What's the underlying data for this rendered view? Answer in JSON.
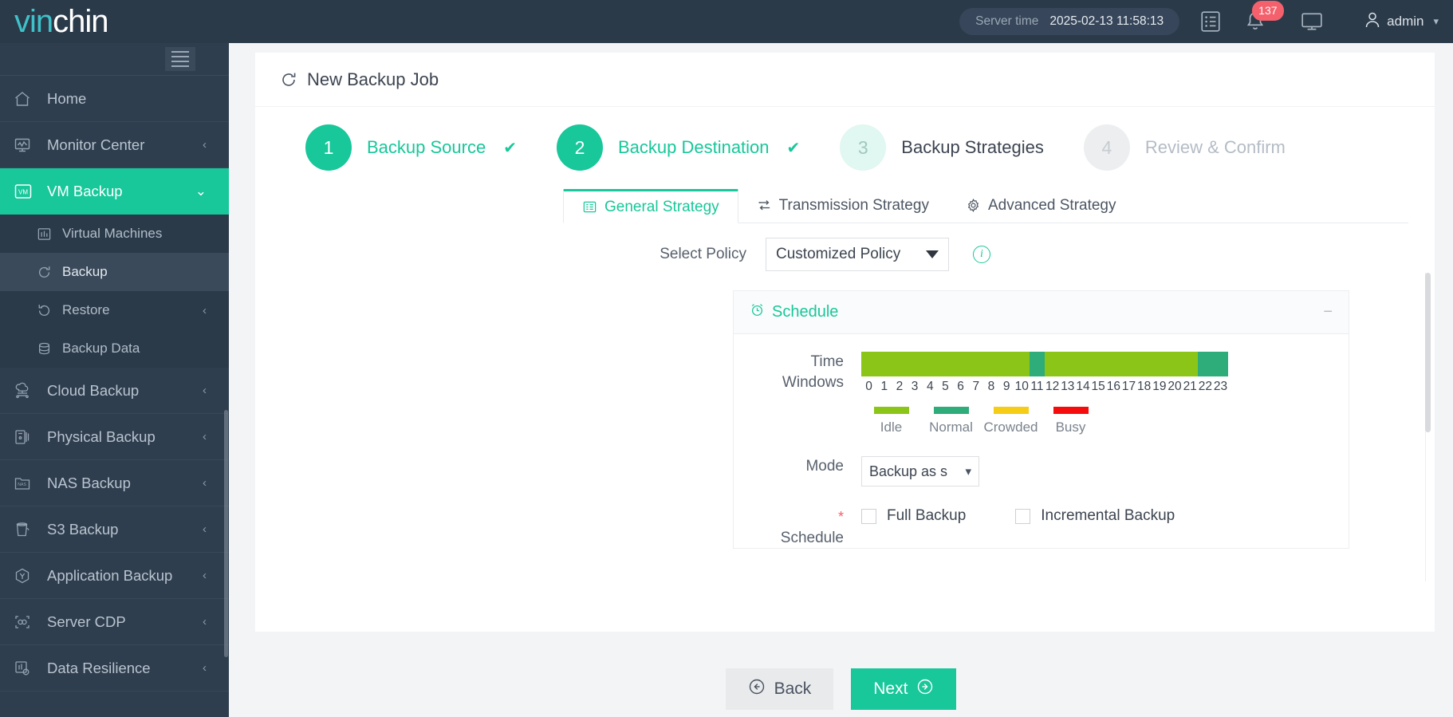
{
  "brand": {
    "part1": "vin",
    "part2": "chin"
  },
  "header": {
    "server_time_label": "Server time",
    "server_time_value": "2025-02-13 11:58:13",
    "notifications_count": "137",
    "user_name": "admin",
    "icons": [
      "list-icon",
      "bell-icon",
      "screen-icon",
      "user-icon",
      "chevron-down-icon"
    ]
  },
  "sidebar": {
    "items": [
      {
        "label": "Home",
        "icon": "home-icon",
        "arrow": "",
        "state": "normal"
      },
      {
        "label": "Monitor Center",
        "icon": "monitor-icon",
        "arrow": "‹",
        "state": "normal"
      },
      {
        "label": "VM Backup",
        "icon": "vm-icon",
        "arrow": "⌄",
        "state": "active"
      },
      {
        "label": "Cloud Backup",
        "icon": "cloud-icon",
        "arrow": "‹",
        "state": "normal"
      },
      {
        "label": "Physical Backup",
        "icon": "server-icon",
        "arrow": "‹",
        "state": "normal"
      },
      {
        "label": "NAS Backup",
        "icon": "nas-icon",
        "arrow": "‹",
        "state": "normal"
      },
      {
        "label": "S3 Backup",
        "icon": "bucket-icon",
        "arrow": "‹",
        "state": "normal"
      },
      {
        "label": "Application Backup",
        "icon": "hexagon-icon",
        "arrow": "‹",
        "state": "normal"
      },
      {
        "label": "Server CDP",
        "icon": "cdp-icon",
        "arrow": "‹",
        "state": "normal"
      },
      {
        "label": "Data Resilience",
        "icon": "resilience-icon",
        "arrow": "‹",
        "state": "normal"
      }
    ],
    "subitems": [
      {
        "label": "Virtual Machines",
        "icon": "chart-icon",
        "arrow": "",
        "state": "normal"
      },
      {
        "label": "Backup",
        "icon": "refresh-icon",
        "arrow": "",
        "state": "selected"
      },
      {
        "label": "Restore",
        "icon": "restore-icon",
        "arrow": "‹",
        "state": "normal"
      },
      {
        "label": "Backup Data",
        "icon": "database-icon",
        "arrow": "",
        "state": "normal"
      }
    ]
  },
  "page": {
    "title": "New Backup Job",
    "title_icon": "refresh-icon"
  },
  "stepper": [
    {
      "num": "1",
      "label": "Backup Source",
      "mark": "✔",
      "state": "done"
    },
    {
      "num": "2",
      "label": "Backup Destination",
      "mark": "✔",
      "state": "cur2"
    },
    {
      "num": "3",
      "label": "Backup Strategies",
      "mark": "",
      "state": "active"
    },
    {
      "num": "4",
      "label": "Review & Confirm",
      "mark": "",
      "state": "idle"
    }
  ],
  "tabs": [
    {
      "label": "General Strategy",
      "icon": "general-strategy-icon",
      "selected": true
    },
    {
      "label": "Transmission Strategy",
      "icon": "transfer-icon",
      "selected": false
    },
    {
      "label": "Advanced Strategy",
      "icon": "gear-icon",
      "selected": false
    }
  ],
  "form": {
    "select_policy_label": "Select Policy",
    "select_policy_value": "Customized Policy",
    "info_icon": "info-icon",
    "schedule_panel_title": "Schedule",
    "schedule_panel_icon": "alarm-clock-icon",
    "collapse_icon": "minus-icon",
    "time_windows_label_line1": "Time",
    "time_windows_label_line2": "Windows",
    "mode_label": "Mode",
    "mode_value": "Backup as s",
    "schedule_label": "Schedule",
    "required_mark": "*",
    "full_backup_label": "Full Backup",
    "incremental_backup_label": "Incremental Backup"
  },
  "chart_data": {
    "type": "bar",
    "title": "Time Windows",
    "categories": [
      "0",
      "1",
      "2",
      "3",
      "4",
      "5",
      "6",
      "7",
      "8",
      "9",
      "10",
      "11",
      "12",
      "13",
      "14",
      "15",
      "16",
      "17",
      "18",
      "19",
      "20",
      "21",
      "22",
      "23"
    ],
    "values": [
      "idle",
      "idle",
      "idle",
      "idle",
      "idle",
      "idle",
      "idle",
      "idle",
      "idle",
      "idle",
      "idle",
      "normal",
      "idle",
      "idle",
      "idle",
      "idle",
      "idle",
      "idle",
      "idle",
      "idle",
      "idle",
      "idle",
      "normal",
      "normal"
    ],
    "legend": [
      {
        "label": "Idle",
        "color": "#8bc518"
      },
      {
        "label": "Normal",
        "color": "#2eac79"
      },
      {
        "label": "Crowded",
        "color": "#f5cc16"
      },
      {
        "label": "Busy",
        "color": "#f50d0d"
      }
    ],
    "colors": {
      "idle": "#8bc518",
      "normal": "#2eac79",
      "crowded": "#f5cc16",
      "busy": "#f50d0d"
    },
    "xlabel": "",
    "ylabel": "",
    "grid": false,
    "legend_position": "bottom-left"
  },
  "footer": {
    "back_label": "Back",
    "next_label": "Next"
  },
  "colors": {
    "accent": "#18c79a",
    "sidebar": "#2f3e4e",
    "topbar": "#2b3a49",
    "badge": "#f4606c"
  }
}
